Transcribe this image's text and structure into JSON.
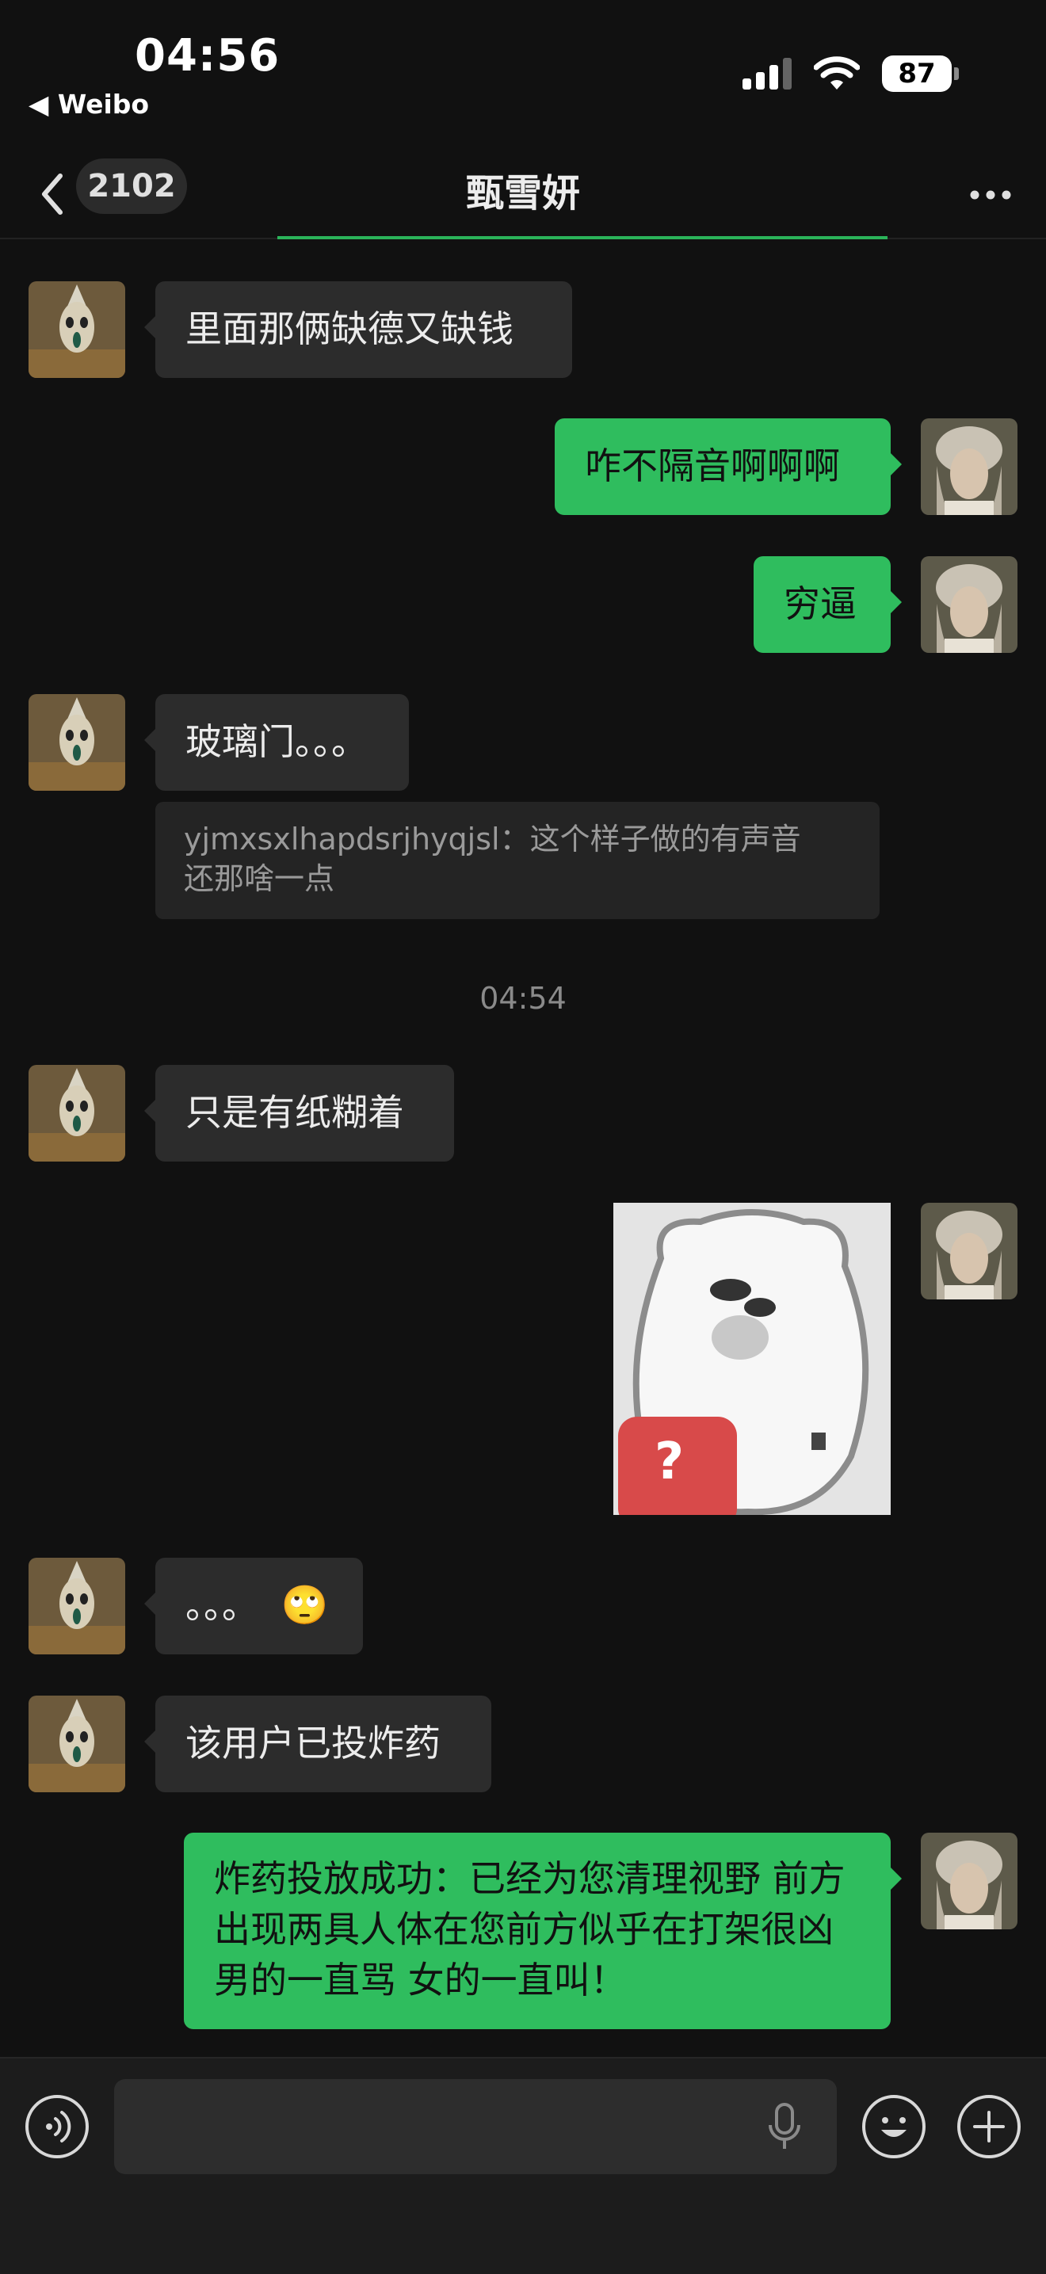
{
  "status_bar": {
    "time": "04:56",
    "back_app": "◀ Weibo",
    "battery": "87"
  },
  "nav": {
    "badge": "2102",
    "title": "甄雪妍"
  },
  "messages": {
    "m1": "里面那俩缺德又缺钱",
    "m2": "咋不隔音啊啊啊",
    "m3": "穷逼",
    "m4": "玻璃门。。。",
    "m4_quote_line1": "yjmxsxlhapdsrjhyqjsl：这个样子做的有声音",
    "m4_quote_line2": "还那啥一点",
    "time_separator": "04:54",
    "m5": "只是有纸糊着",
    "m6_sticker": "?",
    "m7": "。。。",
    "m7_emoji": "🙄",
    "m8": "该用户已投炸药",
    "m9": "炸药投放成功：已经为您清理视野 前方出现两具人体在您前方似乎在打架很凶 男的一直骂 女的一直叫！"
  },
  "input_bar": {
    "placeholder": ""
  },
  "colors": {
    "background": "#111111",
    "bubble_in": "#2c2c2c",
    "bubble_out": "#2fbd5e",
    "sticker_tag": "#d84a4a"
  },
  "icons": [
    "back-chevron-icon",
    "more-icon",
    "voice-icon",
    "microphone-icon",
    "emoji-icon",
    "plus-icon",
    "wifi-icon",
    "signal-icon",
    "battery-icon"
  ]
}
